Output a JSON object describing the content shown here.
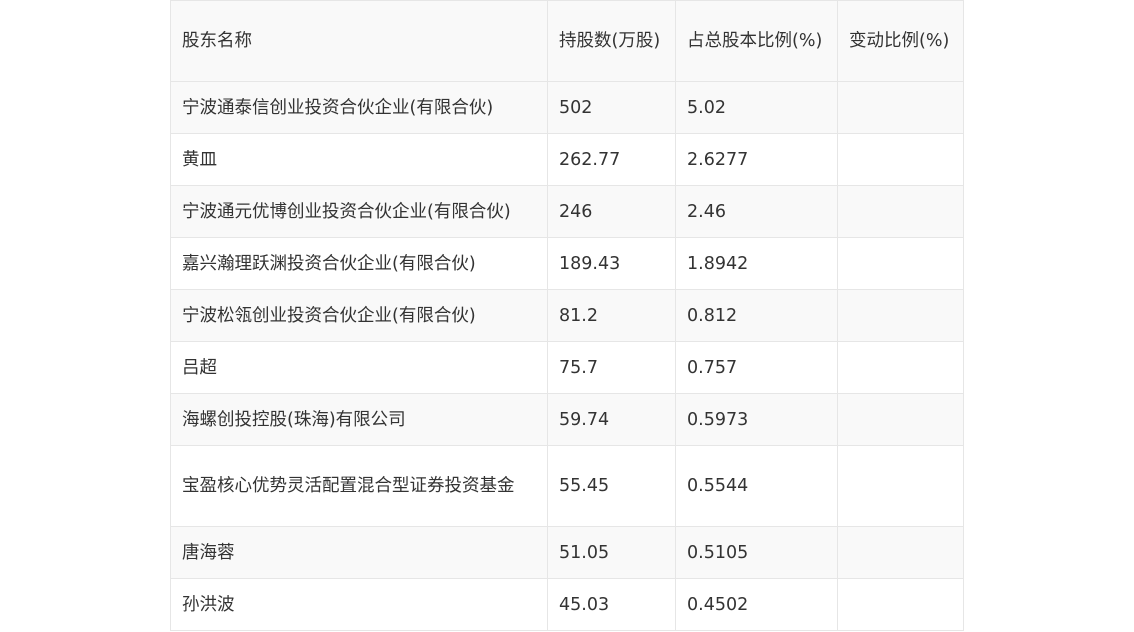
{
  "table": {
    "headers": [
      "股东名称",
      "持股数(万股)",
      "占总股本比例(%)",
      "变动比例(%)"
    ],
    "rows": [
      [
        "宁波通泰信创业投资合伙企业(有限合伙)",
        "502",
        "5.02",
        ""
      ],
      [
        "黄皿",
        "262.77",
        "2.6277",
        ""
      ],
      [
        "宁波通元优博创业投资合伙企业(有限合伙)",
        "246",
        "2.46",
        ""
      ],
      [
        "嘉兴瀚理跃渊投资合伙企业(有限合伙)",
        "189.43",
        "1.8942",
        ""
      ],
      [
        "宁波松瓴创业投资合伙企业(有限合伙)",
        "81.2",
        "0.812",
        ""
      ],
      [
        "吕超",
        "75.7",
        "0.757",
        ""
      ],
      [
        "海螺创投控股(珠海)有限公司",
        "59.74",
        "0.5973",
        ""
      ],
      [
        "宝盈核心优势灵活配置混合型证券投资基金",
        "55.45",
        "0.5544",
        ""
      ],
      [
        "唐海蓉",
        "51.05",
        "0.5105",
        ""
      ],
      [
        "孙洪波",
        "45.03",
        "0.4502",
        ""
      ]
    ]
  }
}
